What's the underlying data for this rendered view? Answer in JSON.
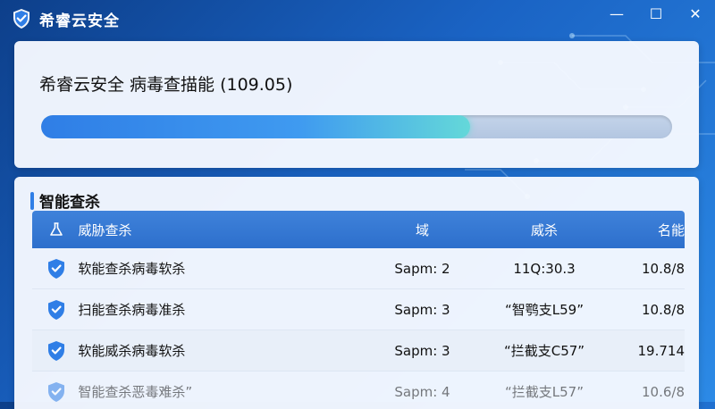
{
  "window": {
    "title": "希睿云安全",
    "controls": {
      "minimize": "—",
      "maximize": "☐",
      "close": "✕"
    }
  },
  "scan": {
    "title": "希睿云安全 病毒查描能 (109.05)",
    "progress": 0.68
  },
  "results": {
    "section_title": "智能查杀",
    "columns": [
      "威胁查杀",
      "域",
      "威杀",
      "名能"
    ],
    "rows": [
      {
        "name": "软能查杀病毒软杀",
        "b": "Sapm: 2",
        "c": "11Q:30.3",
        "d": "10.8/8"
      },
      {
        "name": "扫能查杀病毒准杀",
        "b": "Sapm: 3",
        "c": "“智鹗支L59”",
        "d": "10.8/8"
      },
      {
        "name": "软能威杀病毒软杀",
        "b": "Sapm: 3",
        "c": "“拦截支C57”",
        "d": "19.714"
      },
      {
        "name": "智能查杀恶毒难杀”",
        "b": "Sapm: 4",
        "c": "“拦截支L57”",
        "d": "10.6/8"
      }
    ]
  },
  "colors": {
    "accent": "#2f7ee6",
    "header_bg": "#2d6fcc",
    "shield": "#2f7ee6"
  }
}
